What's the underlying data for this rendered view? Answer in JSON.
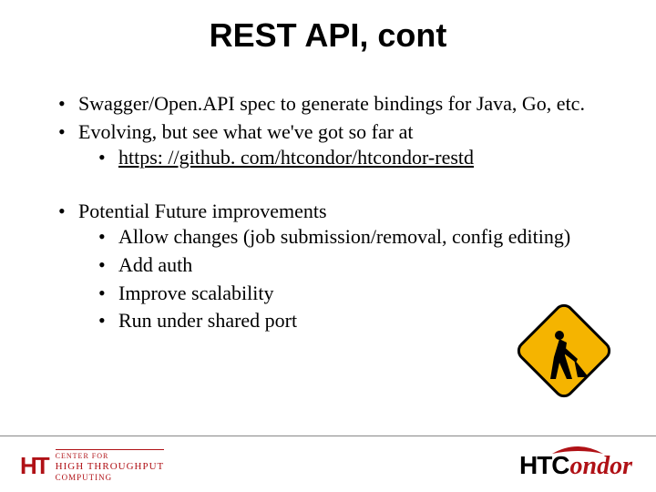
{
  "title": "REST API, cont",
  "bullets": {
    "b1": "Swagger/Open.API spec to generate bindings for Java, Go, etc.",
    "b2": "Evolving, but see what we've got so far at",
    "b2_link": "https: //github. com/htcondor/htcondor-restd",
    "b3": "Potential Future improvements",
    "b3a": "Allow changes (job submission/removal, config editing)",
    "b3b": "Add auth",
    "b3c": "Improve scalability",
    "b3d": "Run under shared port"
  },
  "footer": {
    "left_line1": "CENTER FOR",
    "left_line2": "HIGH THROUGHPUT",
    "left_line3": "COMPUTING",
    "left_mark": "HT",
    "right_ht": "HTC",
    "right_ondor": "ondor"
  }
}
